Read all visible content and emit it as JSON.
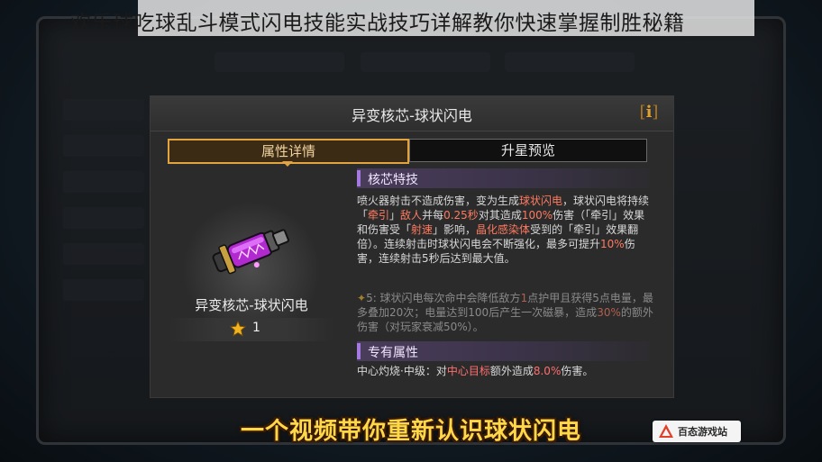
{
  "header": {
    "title": "欢乐球吃球乱斗模式闪电技能实战技巧详解教你快速掌握制胜秘籍"
  },
  "dialog": {
    "title": "异变核芯-球状闪电",
    "info_icon": "info-icon",
    "tabs": [
      {
        "label": "属性详情",
        "active": true
      },
      {
        "label": "升星预览",
        "active": false
      }
    ]
  },
  "item": {
    "name": "异变核芯-球状闪电",
    "icon": "purple-cannon-icon",
    "star_icon": "star-icon",
    "star_count": "1"
  },
  "core_skill": {
    "heading": "核芯特技",
    "p1": "喷火器射击不造成伤害，变为生成",
    "p1_hl1": "球状闪电",
    "p2": "，球状闪电将持续「",
    "p2_hl1": "牵引",
    "p3": "」",
    "p3_hl1": "敌人",
    "p4": "并每",
    "p4_hl1": "0.25秒",
    "p5": "对其造成",
    "p5_hl1": "100%",
    "p6": "伤害（「牵引」效果和伤害受「",
    "p6_hl1": "射速",
    "p7": "」影响，",
    "p7_hl1": "晶化感染体",
    "p8": "受到的「牵引」效果翻倍）。连续射击时球状闪电会不断强化，最多可提升",
    "p8_hl1": "10%",
    "p9": "伤害，连续射击5秒后达到最大值。"
  },
  "star_bonus": {
    "star_glyph": "✦",
    "p1": "5: 球状闪电每次命中会降低敌方",
    "p1_hl": "1",
    "p2": "点护甲且获得5点电量，最多叠加20次；电量达到100后产生一次磁暴，造成",
    "p2_hl": "30%",
    "p3": "的额外伤害（对玩家衰减50%）。"
  },
  "exclusive": {
    "heading": "专有属性",
    "p1": "中心灼烧·中级：对",
    "p1_hl": "中心目标",
    "p2": "额外造成",
    "p2_hl": "8.0%",
    "p3": "伤害。"
  },
  "caption": "一个视频带你重新认识球状闪电",
  "watermark": "百态游戏站",
  "colors": {
    "accent_gold": "#e2a440",
    "highlight_red": "#ff7a60",
    "section_purple": "#a47ae0",
    "caption_yellow": "#ffd84a"
  }
}
